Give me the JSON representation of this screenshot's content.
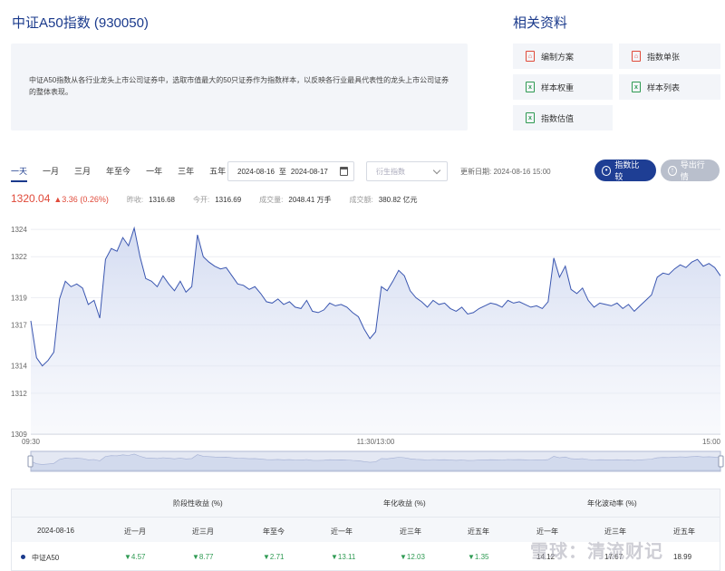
{
  "header": {
    "title": "中证A50指数 (930050)"
  },
  "description": "中证A50指数从各行业龙头上市公司证券中，选取市值最大的50只证券作为指数样本，以反映各行业最具代表性的龙头上市公司证券的整体表现。",
  "related": {
    "title": "相关资料",
    "docs": [
      {
        "label": "编制方案",
        "icon": "pdf-icon"
      },
      {
        "label": "指数单张",
        "icon": "pdf-icon"
      },
      {
        "label": "样本权重",
        "icon": "excel-icon"
      },
      {
        "label": "样本列表",
        "icon": "excel-icon"
      },
      {
        "label": "指数估值",
        "icon": "excel-icon"
      }
    ]
  },
  "toolbar": {
    "ranges": [
      "一天",
      "一月",
      "三月",
      "年至今",
      "一年",
      "三年",
      "五年"
    ],
    "active_range": "一天",
    "date_from": "2024-08-16",
    "date_sep": "至",
    "date_to": "2024-08-17",
    "derived_placeholder": "衍生指数",
    "update_time": "更新日期: 2024-08-16 15:00",
    "compare_label": "指数比较",
    "export_label": "导出行情"
  },
  "quote": {
    "price": "1320.04",
    "change": "▲3.36 (0.26%)",
    "prev_close_label": "昨收:",
    "prev_close": "1316.68",
    "open_label": "今开:",
    "open": "1316.69",
    "volume_label": "成交量:",
    "volume": "2048.41 万手",
    "amount_label": "成交额:",
    "amount": "380.82 亿元"
  },
  "colors": {
    "accent": "#1e3e94",
    "up": "#e04a3a",
    "down": "#2e9a52",
    "line": "#3a56b0"
  },
  "chart_data": {
    "type": "area",
    "x_ticks": [
      "09:30",
      "11:30/13:00",
      "15:00"
    ],
    "y_ticks": [
      1309,
      1312,
      1314,
      1317,
      1319,
      1322,
      1324
    ],
    "ylim": [
      1309,
      1325
    ],
    "x": [
      0,
      2,
      4,
      6,
      8,
      10,
      12,
      14,
      16,
      18,
      20,
      22,
      24,
      26,
      28,
      30,
      32,
      34,
      36,
      38,
      40,
      42,
      44,
      46,
      48,
      50,
      52,
      54,
      56,
      58,
      60,
      62,
      64,
      66,
      68,
      70,
      72,
      74,
      76,
      78,
      80,
      82,
      84,
      86,
      88,
      90,
      92,
      94,
      96,
      98,
      100,
      102,
      104,
      106,
      108,
      110,
      112,
      114,
      116,
      118,
      120,
      122,
      124,
      126,
      128,
      130,
      132,
      134,
      136,
      138,
      140,
      142,
      144,
      146,
      148,
      150,
      152,
      154,
      156,
      158,
      160,
      162,
      164,
      166,
      168,
      170,
      172,
      174,
      176,
      178,
      180,
      182,
      184,
      186,
      188,
      190,
      192,
      194,
      196,
      198,
      200,
      202,
      204,
      206,
      208,
      210,
      212,
      214,
      216,
      218,
      220,
      222,
      224,
      226,
      228,
      230,
      232,
      234,
      236,
      238,
      240
    ],
    "values": [
      1317.3,
      1314.6,
      1314.0,
      1314.4,
      1315.0,
      1318.9,
      1320.2,
      1319.8,
      1320.0,
      1319.7,
      1318.5,
      1318.8,
      1317.5,
      1321.8,
      1322.6,
      1322.4,
      1323.4,
      1322.8,
      1324.1,
      1322.0,
      1320.4,
      1320.2,
      1319.8,
      1320.6,
      1320.0,
      1319.5,
      1320.2,
      1319.4,
      1319.8,
      1323.6,
      1322.0,
      1321.6,
      1321.3,
      1321.1,
      1321.2,
      1320.6,
      1320.0,
      1319.9,
      1319.6,
      1319.8,
      1319.3,
      1318.7,
      1318.6,
      1318.9,
      1318.5,
      1318.7,
      1318.3,
      1318.2,
      1318.8,
      1318.0,
      1317.9,
      1318.1,
      1318.6,
      1318.4,
      1318.5,
      1318.3,
      1317.9,
      1317.6,
      1316.7,
      1316.0,
      1316.5,
      1319.8,
      1319.5,
      1320.2,
      1321.0,
      1320.6,
      1319.5,
      1319.0,
      1318.7,
      1318.3,
      1318.8,
      1318.5,
      1318.6,
      1318.2,
      1318.0,
      1318.3,
      1317.8,
      1317.9,
      1318.2,
      1318.4,
      1318.6,
      1318.5,
      1318.3,
      1318.8,
      1318.6,
      1318.7,
      1318.5,
      1318.3,
      1318.4,
      1318.2,
      1318.7,
      1321.9,
      1320.5,
      1321.3,
      1319.6,
      1319.3,
      1319.7,
      1318.8,
      1318.3,
      1318.6,
      1318.5,
      1318.4,
      1318.6,
      1318.2,
      1318.5,
      1318.0,
      1318.4,
      1318.8,
      1319.2,
      1320.5,
      1320.8,
      1320.7,
      1321.1,
      1321.4,
      1321.2,
      1321.6,
      1321.8,
      1321.3,
      1321.5,
      1321.2,
      1320.6
    ]
  },
  "table": {
    "group_headers": [
      "阶段性收益 (%)",
      "年化收益 (%)",
      "年化波动率 (%)"
    ],
    "date_label": "2024-08-16",
    "columns": [
      "近一月",
      "近三月",
      "年至今",
      "近一年",
      "近三年",
      "近五年",
      "近一年",
      "近三年",
      "近五年"
    ],
    "rows": [
      {
        "name": "中证A50",
        "values": [
          "▼4.57",
          "▼8.77",
          "▼2.71",
          "▼13.11",
          "▼12.03",
          "▼1.35",
          "14.12",
          "17.67",
          "18.99"
        ]
      }
    ]
  },
  "watermark": "雪球：清流财记"
}
